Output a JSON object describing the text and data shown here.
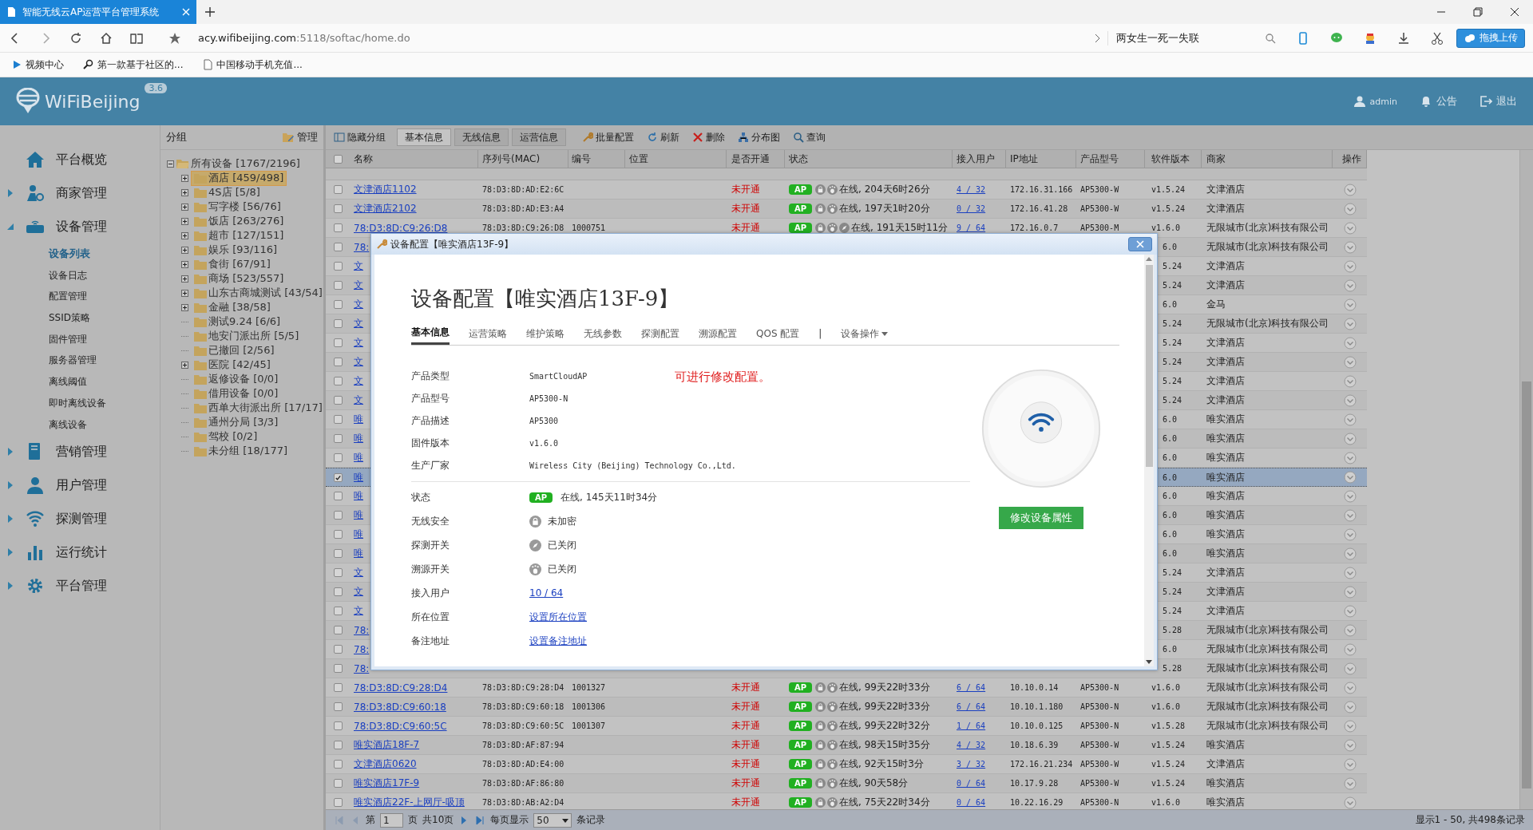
{
  "browser": {
    "tab_title": "智能无线云AP运营平台管理系统",
    "url_host": "acy.wifibeijing.com",
    "url_rest": ":5118/softac/home.do",
    "search_value": "两女生一死一失联",
    "upload_button": "拖拽上传",
    "bookmarks": [
      {
        "label": "视频中心",
        "kind": "video"
      },
      {
        "label": "第一款基于社区的...",
        "kind": "search"
      },
      {
        "label": "中国移动手机充值...",
        "kind": "page"
      }
    ]
  },
  "header": {
    "logo": "WiFiBeijing",
    "version": "3.6",
    "user": "admin",
    "notice": "公告",
    "logout": "退出"
  },
  "sidebar": {
    "items": [
      {
        "label": "平台概览"
      },
      {
        "label": "商家管理",
        "expanded": false
      },
      {
        "label": "设备管理",
        "expanded": true,
        "children": [
          {
            "label": "设备列表",
            "selected": true
          },
          {
            "label": "设备日志",
            "selected": false
          },
          {
            "label": "配置管理",
            "selected": false
          },
          {
            "label": "SSID策略",
            "selected": false
          },
          {
            "label": "固件管理",
            "selected": false
          },
          {
            "label": "服务器管理",
            "selected": false
          },
          {
            "label": "离线阈值",
            "selected": false
          },
          {
            "label": "即时离线设备",
            "selected": false
          },
          {
            "label": "离线设备",
            "selected": false
          }
        ]
      },
      {
        "label": "营销管理",
        "expanded": false
      },
      {
        "label": "用户管理",
        "expanded": false
      },
      {
        "label": "探测管理",
        "expanded": false
      },
      {
        "label": "运行统计",
        "expanded": false
      },
      {
        "label": "平台管理",
        "expanded": false
      }
    ]
  },
  "groups": {
    "title": "分组",
    "manage": "管理",
    "tree": {
      "label": "所有设备 [1767/2196]",
      "expanded": true,
      "children": [
        {
          "label": "酒店 [459/498]",
          "has_children": true,
          "selected": true
        },
        {
          "label": "4S店 [5/8]",
          "has_children": true,
          "selected": false
        },
        {
          "label": "写字楼 [56/76]",
          "has_children": true,
          "selected": false
        },
        {
          "label": "饭店 [263/276]",
          "has_children": true,
          "selected": false
        },
        {
          "label": "超市 [127/151]",
          "has_children": true,
          "selected": false
        },
        {
          "label": "娱乐 [93/116]",
          "has_children": true,
          "selected": false
        },
        {
          "label": "食街 [67/91]",
          "has_children": true,
          "selected": false
        },
        {
          "label": "商场 [523/557]",
          "has_children": true,
          "selected": false
        },
        {
          "label": "山东古商城测试 [43/54]",
          "has_children": true,
          "selected": false
        },
        {
          "label": "金融 [38/58]",
          "has_children": true,
          "selected": false
        },
        {
          "label": "测试9.24 [6/6]",
          "has_children": false,
          "selected": false
        },
        {
          "label": "地安门派出所 [5/5]",
          "has_children": false,
          "selected": false
        },
        {
          "label": "已撤回 [2/56]",
          "has_children": false,
          "selected": false
        },
        {
          "label": "医院 [42/45]",
          "has_children": true,
          "selected": false
        },
        {
          "label": "返修设备 [0/0]",
          "has_children": false,
          "selected": false
        },
        {
          "label": "借用设备 [0/0]",
          "has_children": false,
          "selected": false
        },
        {
          "label": "西单大街派出所 [17/17]",
          "has_children": false,
          "selected": false
        },
        {
          "label": "通州分局 [3/3]",
          "has_children": false,
          "selected": false
        },
        {
          "label": "驾校 [0/2]",
          "has_children": false,
          "selected": false
        },
        {
          "label": "未分组 [18/177]",
          "has_children": false,
          "selected": false
        }
      ]
    }
  },
  "toolbar": {
    "buttons": [
      {
        "label": "隐藏分组",
        "kind": "toggle"
      },
      {
        "label": "基本信息",
        "kind": "tab",
        "selected": true
      },
      {
        "label": "无线信息",
        "kind": "tab",
        "selected": false
      },
      {
        "label": "运营信息",
        "kind": "tab",
        "selected": false
      },
      {
        "label": "批量配置",
        "kind": "wrench"
      },
      {
        "label": "刷新",
        "kind": "refresh"
      },
      {
        "label": "删除",
        "kind": "delete"
      },
      {
        "label": "分布图",
        "kind": "map"
      },
      {
        "label": "查询",
        "kind": "search"
      }
    ]
  },
  "table": {
    "all_checked": false,
    "columns": [
      "名称",
      "序列号(MAC)",
      "编号",
      "位置",
      "是否开通",
      "状态",
      "接入用户",
      "IP地址",
      "产品型号",
      "软件版本",
      "商家",
      "操作"
    ],
    "rows": [
      {
        "kind": "full",
        "checked": false,
        "selected": false,
        "name": "文津酒店1102",
        "mac": "78:D3:8D:AD:E2:6C",
        "number": "",
        "enabled": "未开通",
        "badge": "AP",
        "probe": false,
        "status": "在线, 204天6时26分",
        "users": "4 / 32",
        "ip": "172.16.31.166",
        "model": "AP5300-W",
        "version": "v1.5.24",
        "merchant": "文津酒店"
      },
      {
        "kind": "full",
        "checked": false,
        "selected": false,
        "name": "文津酒店2102",
        "mac": "78:D3:8D:AD:E3:A4",
        "number": "",
        "enabled": "未开通",
        "badge": "AP",
        "probe": false,
        "status": "在线, 197天1时20分",
        "users": "0 / 32",
        "ip": "172.16.41.28",
        "model": "AP5300-W",
        "version": "v1.5.24",
        "merchant": "文津酒店"
      },
      {
        "kind": "full",
        "checked": false,
        "selected": false,
        "name": "78:D3:8D:C9:26:D8",
        "mac": "78:D3:8D:C9:26:D8",
        "number": "1000751",
        "enabled": "未开通",
        "badge": "AP",
        "probe": true,
        "status": "在线, 191天15时11分",
        "users": "9 / 64",
        "ip": "172.16.0.7",
        "model": "AP5300-M",
        "version": "v1.6.0",
        "merchant": "无限城市(北京)科技有限公司"
      },
      {
        "kind": "covered",
        "checked": false,
        "selected": false,
        "name": "78:",
        "version": "6.0",
        "merchant": "无限城市(北京)科技有限公司"
      },
      {
        "kind": "covered",
        "checked": false,
        "selected": false,
        "name": "文",
        "version": "5.24",
        "merchant": "文津酒店"
      },
      {
        "kind": "covered",
        "checked": false,
        "selected": false,
        "name": "文",
        "version": "5.24",
        "merchant": "文津酒店"
      },
      {
        "kind": "covered",
        "checked": false,
        "selected": false,
        "name": "文",
        "version": "6.0",
        "merchant": "金马"
      },
      {
        "kind": "covered",
        "checked": false,
        "selected": false,
        "name": "文",
        "version": "5.24",
        "merchant": "无限城市(北京)科技有限公司"
      },
      {
        "kind": "covered",
        "checked": false,
        "selected": false,
        "name": "文",
        "version": "5.24",
        "merchant": "文津酒店"
      },
      {
        "kind": "covered",
        "checked": false,
        "selected": false,
        "name": "文",
        "version": "5.24",
        "merchant": "文津酒店"
      },
      {
        "kind": "covered",
        "checked": false,
        "selected": false,
        "name": "文",
        "version": "5.24",
        "merchant": "文津酒店"
      },
      {
        "kind": "covered",
        "checked": false,
        "selected": false,
        "name": "文",
        "version": "5.24",
        "merchant": "文津酒店"
      },
      {
        "kind": "covered",
        "checked": false,
        "selected": false,
        "name": "唯",
        "version": "6.0",
        "merchant": "唯实酒店"
      },
      {
        "kind": "covered",
        "checked": false,
        "selected": false,
        "name": "唯",
        "version": "6.0",
        "merchant": "唯实酒店"
      },
      {
        "kind": "covered",
        "checked": false,
        "selected": false,
        "name": "唯",
        "version": "6.0",
        "merchant": "唯实酒店"
      },
      {
        "kind": "covered",
        "checked": true,
        "selected": true,
        "name": "唯",
        "version": "6.0",
        "merchant": "唯实酒店"
      },
      {
        "kind": "covered",
        "checked": false,
        "selected": false,
        "name": "唯",
        "version": "6.0",
        "merchant": "唯实酒店"
      },
      {
        "kind": "covered",
        "checked": false,
        "selected": false,
        "name": "唯",
        "version": "6.0",
        "merchant": "唯实酒店"
      },
      {
        "kind": "covered",
        "checked": false,
        "selected": false,
        "name": "唯",
        "version": "6.0",
        "merchant": "唯实酒店"
      },
      {
        "kind": "covered",
        "checked": false,
        "selected": false,
        "name": "唯",
        "version": "6.0",
        "merchant": "唯实酒店"
      },
      {
        "kind": "covered",
        "checked": false,
        "selected": false,
        "name": "文",
        "version": "5.24",
        "merchant": "文津酒店"
      },
      {
        "kind": "covered",
        "checked": false,
        "selected": false,
        "name": "文",
        "version": "5.24",
        "merchant": "文津酒店"
      },
      {
        "kind": "covered",
        "checked": false,
        "selected": false,
        "name": "文",
        "version": "5.24",
        "merchant": "文津酒店"
      },
      {
        "kind": "covered",
        "checked": false,
        "selected": false,
        "name": "78:",
        "version": "5.28",
        "merchant": "无限城市(北京)科技有限公司"
      },
      {
        "kind": "covered",
        "checked": false,
        "selected": false,
        "name": "78:",
        "version": "6.0",
        "merchant": "无限城市(北京)科技有限公司"
      },
      {
        "kind": "covered",
        "checked": false,
        "selected": false,
        "name": "78:",
        "version": "5.28",
        "merchant": "无限城市(北京)科技有限公司"
      },
      {
        "kind": "full",
        "checked": false,
        "selected": false,
        "name": "78:D3:8D:C9:28:D4",
        "mac": "78:D3:8D:C9:28:D4",
        "number": "1001327",
        "enabled": "未开通",
        "badge": "AP",
        "probe": false,
        "status": "在线, 99天22时33分",
        "users": "6 / 64",
        "ip": "10.10.0.14",
        "model": "AP5300-N",
        "version": "v1.6.0",
        "merchant": "无限城市(北京)科技有限公司"
      },
      {
        "kind": "full",
        "checked": false,
        "selected": false,
        "name": "78:D3:8D:C9:60:18",
        "mac": "78:D3:8D:C9:60:18",
        "number": "1001306",
        "enabled": "未开通",
        "badge": "AP",
        "probe": false,
        "status": "在线, 99天22时33分",
        "users": "6 / 64",
        "ip": "10.10.1.180",
        "model": "AP5300-N",
        "version": "v1.6.0",
        "merchant": "无限城市(北京)科技有限公司"
      },
      {
        "kind": "full",
        "checked": false,
        "selected": false,
        "name": "78:D3:8D:C9:60:5C",
        "mac": "78:D3:8D:C9:60:5C",
        "number": "1001307",
        "enabled": "未开通",
        "badge": "AP",
        "probe": false,
        "status": "在线, 99天22时32分",
        "users": "1 / 64",
        "ip": "10.10.0.125",
        "model": "AP5300-N",
        "version": "v1.5.28",
        "merchant": "无限城市(北京)科技有限公司"
      },
      {
        "kind": "full",
        "checked": false,
        "selected": false,
        "name": "唯实酒店18F-7",
        "mac": "78:D3:8D:AF:87:94",
        "number": "",
        "enabled": "未开通",
        "badge": "AP",
        "probe": false,
        "status": "在线, 98天15时35分",
        "users": "4 / 32",
        "ip": "10.18.6.39",
        "model": "AP5300-W",
        "version": "v1.5.24",
        "merchant": "唯实酒店"
      },
      {
        "kind": "full",
        "checked": false,
        "selected": false,
        "name": "文津酒店0620",
        "mac": "78:D3:8D:AD:E4:00",
        "number": "",
        "enabled": "未开通",
        "badge": "AP",
        "probe": false,
        "status": "在线, 92天15时3分",
        "users": "3 / 32",
        "ip": "172.16.21.234",
        "model": "AP5300-W",
        "version": "v1.5.24",
        "merchant": "文津酒店"
      },
      {
        "kind": "full",
        "checked": false,
        "selected": false,
        "name": "唯实酒店17F-9",
        "mac": "78:D3:8D:AF:86:80",
        "number": "",
        "enabled": "未开通",
        "badge": "AP",
        "probe": false,
        "status": "在线, 90天58分",
        "users": "0 / 64",
        "ip": "10.17.9.28",
        "model": "AP5300-W",
        "version": "v1.5.24",
        "merchant": "唯实酒店"
      },
      {
        "kind": "full",
        "checked": false,
        "selected": false,
        "name": "唯实酒店22F-上网厅-吸顶",
        "mac": "78:D3:8D:AB:A2:D4",
        "number": "",
        "enabled": "未开通",
        "badge": "AP",
        "probe": false,
        "status": "在线, 75天22时34分",
        "users": "0 / 64",
        "ip": "10.22.16.29",
        "model": "AP5300-N",
        "version": "v1.6.0",
        "merchant": "唯实酒店"
      }
    ]
  },
  "pager": {
    "page_prefix": "第",
    "page": "1",
    "page_suffix": "页",
    "total_pages": "共10页",
    "per_page_label": "每页显示",
    "per_page": "50",
    "per_page_suffix": "条记录",
    "summary": "显示1 - 50, 共498条记录"
  },
  "dialog": {
    "title": "设备配置【唯实酒店13F-9】",
    "heading": "设备配置【唯实酒店13F-9】",
    "tabs": [
      {
        "label": "基本信息",
        "kind": "tab",
        "selected": true
      },
      {
        "label": "运营策略",
        "kind": "tab",
        "selected": false
      },
      {
        "label": "维护策略",
        "kind": "tab",
        "selected": false
      },
      {
        "label": "无线参数",
        "kind": "tab",
        "selected": false
      },
      {
        "label": "探测配置",
        "kind": "tab",
        "selected": false
      },
      {
        "label": "溯源配置",
        "kind": "tab",
        "selected": false
      },
      {
        "label": "QOS 配置",
        "kind": "tab",
        "selected": false
      },
      {
        "label": "|",
        "kind": "separator"
      },
      {
        "label": "设备操作",
        "kind": "menu"
      }
    ],
    "info": [
      {
        "label": "产品类型",
        "value": "SmartCloudAP"
      },
      {
        "label": "产品型号",
        "value": "AP5300-N"
      },
      {
        "label": "产品描述",
        "value": "AP5300"
      },
      {
        "label": "固件版本",
        "value": "v1.6.0"
      },
      {
        "label": "生产厂家",
        "value": "Wireless City (Beijing) Technology Co.,Ltd."
      }
    ],
    "note": "可进行修改配置。",
    "status_rows": [
      {
        "label": "状态",
        "kind": "badge",
        "badge": "AP",
        "value": "在线, 145天11时34分"
      },
      {
        "label": "无线安全",
        "kind": "lock",
        "value": "未加密"
      },
      {
        "label": "探测开关",
        "kind": "compass",
        "value": "已关闭"
      },
      {
        "label": "溯源开关",
        "kind": "footprint",
        "value": "已关闭"
      },
      {
        "label": "接入用户",
        "kind": "link",
        "value": "10 / 64"
      },
      {
        "label": "所在位置",
        "kind": "link",
        "value": "设置所在位置"
      },
      {
        "label": "备注地址",
        "kind": "link",
        "value": "设置备注地址"
      }
    ],
    "button": "修改设备属性"
  }
}
